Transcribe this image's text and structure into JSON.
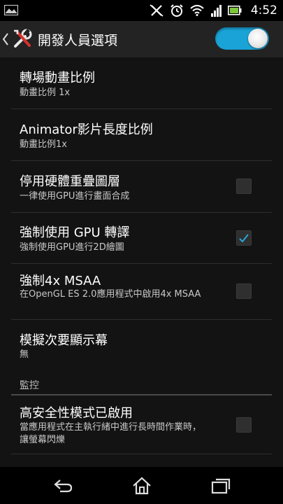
{
  "status_bar": {
    "time": "4:52",
    "icons": [
      "image-icon",
      "mute-icon",
      "alarm-icon",
      "wifi-icon",
      "signal-icon",
      "battery-icon"
    ]
  },
  "action_bar": {
    "title": "開發人員選項",
    "toggle_on": true,
    "accent": "#1aa3d6"
  },
  "settings": [
    {
      "title": "轉場動畫比例",
      "summary": "動畫比例 1x"
    },
    {
      "title": "Animator影片長度比例",
      "summary": "動畫比例1x"
    },
    {
      "title": "停用硬體重疊圖層",
      "summary": "一律使用GPU進行畫面合成",
      "checked": false
    },
    {
      "title": "強制使用 GPU 轉譯",
      "summary": "強制使用GPU進行2D繪圖",
      "checked": true
    },
    {
      "title": "強制4x MSAA",
      "summary": "在OpenGL ES 2.0應用程式中啟用4x MSAA",
      "checked": false
    },
    {
      "title": "模擬次要顯示幕",
      "summary": "無"
    }
  ],
  "section": {
    "label": "監控"
  },
  "monitor_settings": [
    {
      "title": "高安全性模式已啟用",
      "summary": "當應用程式在主執行緒中進行長時間作業時，讓螢幕閃爍",
      "checked": false
    }
  ],
  "nav_bar": {
    "icons": [
      "back-icon",
      "home-icon",
      "recent-apps-icon"
    ]
  }
}
